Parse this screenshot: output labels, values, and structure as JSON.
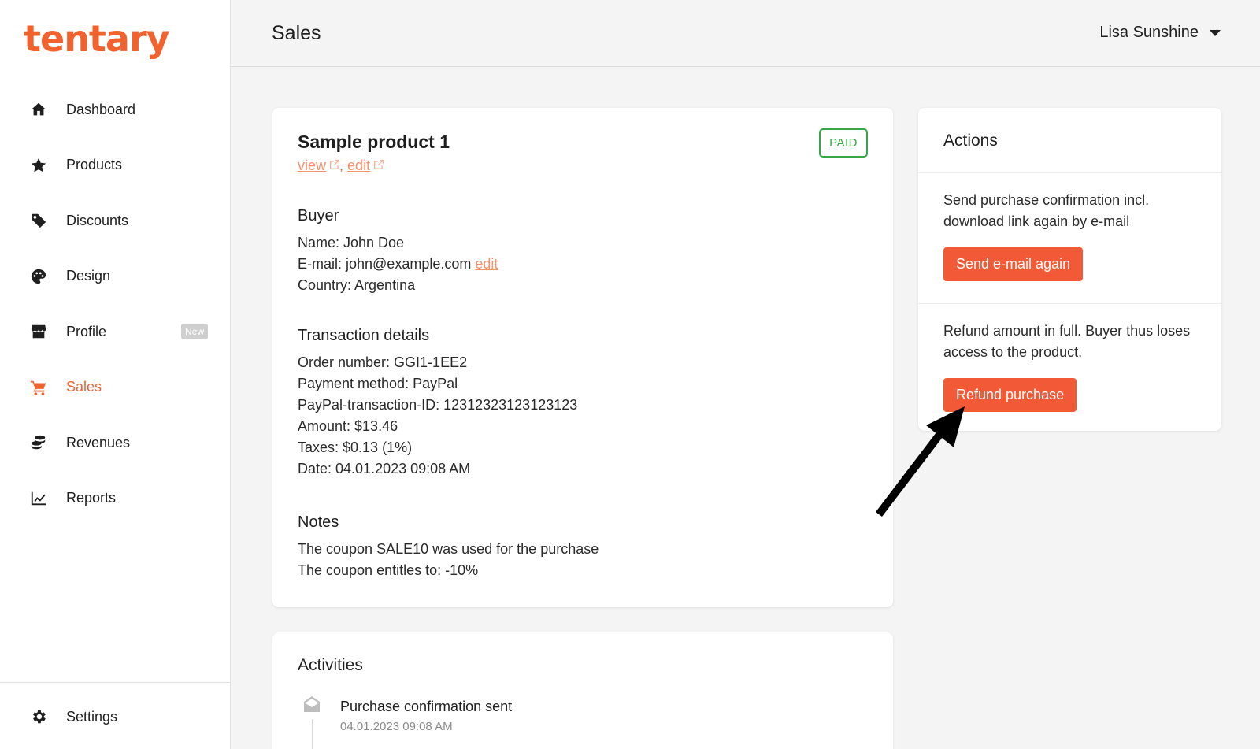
{
  "brand": {
    "logo": "tentary",
    "accent": "#f2622e"
  },
  "sidebar": {
    "items": [
      {
        "label": "Dashboard",
        "icon": "home-icon"
      },
      {
        "label": "Products",
        "icon": "star-icon"
      },
      {
        "label": "Discounts",
        "icon": "tag-icon"
      },
      {
        "label": "Design",
        "icon": "palette-icon"
      },
      {
        "label": "Profile",
        "icon": "store-icon",
        "badge": "New"
      },
      {
        "label": "Sales",
        "icon": "cart-icon",
        "active": true
      },
      {
        "label": "Revenues",
        "icon": "coins-icon"
      },
      {
        "label": "Reports",
        "icon": "chart-icon"
      }
    ],
    "settings": {
      "label": "Settings",
      "icon": "gear-icon"
    }
  },
  "header": {
    "title": "Sales",
    "user": "Lisa Sunshine"
  },
  "product": {
    "title": "Sample product 1",
    "view_link": "view",
    "edit_link": "edit",
    "separator": ",",
    "status": "PAID",
    "status_color": "#37a647"
  },
  "buyer": {
    "heading": "Buyer",
    "name": "Name: John Doe",
    "email": "E-mail: john@example.com",
    "email_edit": "edit",
    "country": "Country: Argentina"
  },
  "transaction": {
    "heading": "Transaction details",
    "lines": [
      "Order number: GGI1-1EE2",
      "Payment method: PayPal",
      "PayPal-transaction-ID: 12312323123123123",
      "Amount: $13.46",
      "Taxes: $0.13 (1%)",
      "Date: 04.01.2023 09:08 AM"
    ]
  },
  "notes": {
    "heading": "Notes",
    "lines": [
      "The coupon SALE10 was used for the purchase",
      "The coupon entitles to: -10%"
    ]
  },
  "activities": {
    "heading": "Activities",
    "items": [
      {
        "title": "Purchase confirmation sent",
        "date": "04.01.2023 09:08 AM",
        "icon": "envelope-open-icon"
      }
    ]
  },
  "actions": {
    "heading": "Actions",
    "resend_desc": "Send purchase confirmation incl. download link again by e-mail",
    "resend_button": "Send e-mail again",
    "refund_desc": "Refund amount in full. Buyer thus loses access to the product.",
    "refund_button": "Refund purchase",
    "button_color": "#f25a37"
  }
}
